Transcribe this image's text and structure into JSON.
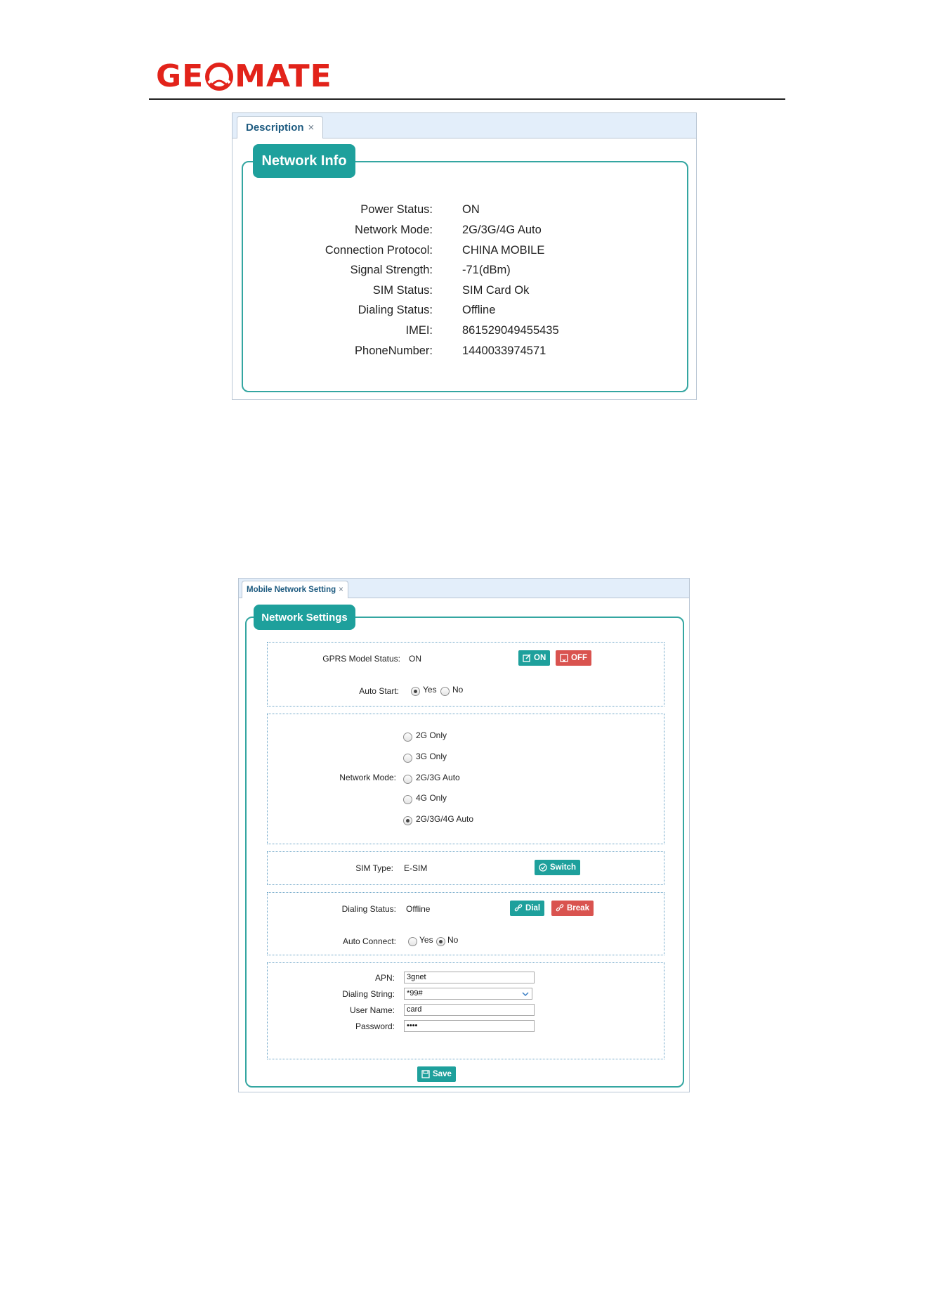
{
  "header": {
    "logo_text_left": "GE",
    "logo_text_right": "MATE"
  },
  "network_info": {
    "tab_label": "Description",
    "tab_close": "×",
    "legend": "Network Info",
    "rows": [
      {
        "label": "Power Status:",
        "value": "ON"
      },
      {
        "label": "Network Mode:",
        "value": "2G/3G/4G Auto"
      },
      {
        "label": "Connection Protocol:",
        "value": "CHINA MOBILE"
      },
      {
        "label": "Signal Strength:",
        "value": "-71(dBm)"
      },
      {
        "label": "SIM Status:",
        "value": "SIM Card Ok"
      },
      {
        "label": "Dialing Status:",
        "value": "Offline"
      },
      {
        "label": "IMEI:",
        "value": "861529049455435"
      },
      {
        "label": "PhoneNumber:",
        "value": "1440033974571"
      }
    ]
  },
  "network_settings": {
    "tab_label": "Mobile Network Setting",
    "tab_close": "×",
    "legend": "Network Settings",
    "gprs": {
      "status_label": "GPRS Model Status:",
      "status_value": "ON",
      "on_button": "ON",
      "off_button": "OFF",
      "auto_start_label": "Auto Start:",
      "auto_start_yes": "Yes",
      "auto_start_no": "No",
      "auto_start_selected": "Yes"
    },
    "network_mode": {
      "label": "Network Mode:",
      "options": [
        "2G Only",
        "3G Only",
        "2G/3G Auto",
        "4G Only",
        "2G/3G/4G Auto"
      ],
      "selected": "2G/3G/4G Auto"
    },
    "sim": {
      "label": "SIM Type:",
      "value": "E-SIM",
      "switch_button": "Switch"
    },
    "dialing": {
      "status_label": "Dialing Status:",
      "status_value": "Offline",
      "dial_button": "Dial",
      "break_button": "Break",
      "auto_connect_label": "Auto Connect:",
      "auto_connect_yes": "Yes",
      "auto_connect_no": "No",
      "auto_connect_selected": "No"
    },
    "apn": {
      "apn_label": "APN:",
      "apn_value": "3gnet",
      "dialing_string_label": "Dialing String:",
      "dialing_string_value": "*99#",
      "user_name_label": "User Name:",
      "user_name_value": "card",
      "password_label": "Password:",
      "password_value": "••••"
    },
    "save_button": "Save"
  },
  "colors": {
    "brand_red": "#e2231a",
    "teal": "#1ea09c",
    "danger": "#d9534f",
    "tab_bar": "#e3eefa"
  }
}
